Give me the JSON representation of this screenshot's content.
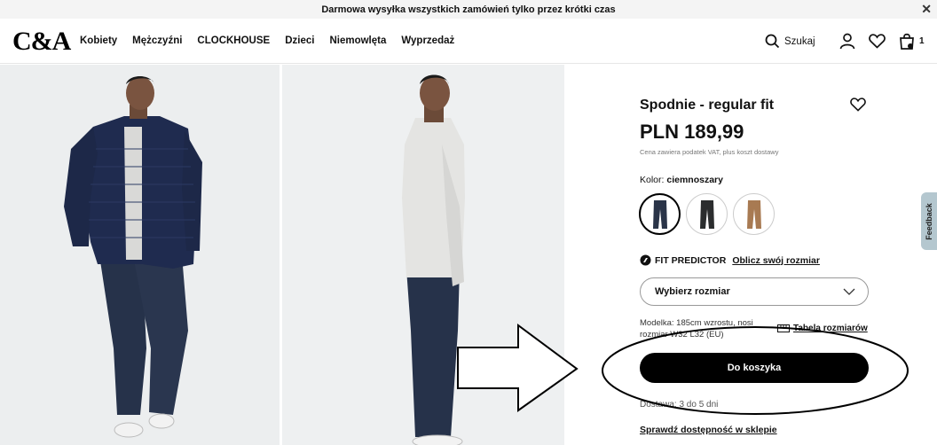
{
  "promo": {
    "text": "Darmowa wysyłka wszystkich zamówień tylko przez krótki czas"
  },
  "header": {
    "logo": "C&A",
    "nav": [
      "Kobiety",
      "Mężczyźni",
      "CLOCKHOUSE",
      "Dzieci",
      "Niemowlęta",
      "Wyprzedaż"
    ],
    "search_label": "Szukaj",
    "cart_count": "1"
  },
  "product": {
    "title": "Spodnie - regular fit",
    "price": "PLN 189,99",
    "vat_note": "Cena zawiera podatek VAT, plus koszt dostawy",
    "color_prefix": "Kolor:",
    "color_name": "ciemnoszary",
    "swatches": [
      {
        "name": "granatowy",
        "color": "#2a3448"
      },
      {
        "name": "ciemnoszary",
        "color": "#2b2d2e"
      },
      {
        "name": "beżowy",
        "color": "#a87a52"
      }
    ],
    "fit_predictor": "FIT PREDICTOR",
    "fit_link": "Oblicz swój rozmiar",
    "size_placeholder": "Wybierz rozmiar",
    "model_info": "Modelka: 185cm wzrostu, nosi rozmiar W32 L32 (EU)",
    "size_table": "Tabela rozmiarów",
    "add_to_cart": "Do koszyka",
    "delivery": "Dostawa: 3 do 5 dni",
    "store_check": "Sprawdź dostępność w sklepie"
  },
  "feedback": "Feedback",
  "colors": {
    "jacket": "#1f2b4f",
    "trousers": "#26324a",
    "sweater": "#e4e4e2",
    "feedback_tab": "#b4c7cf"
  }
}
